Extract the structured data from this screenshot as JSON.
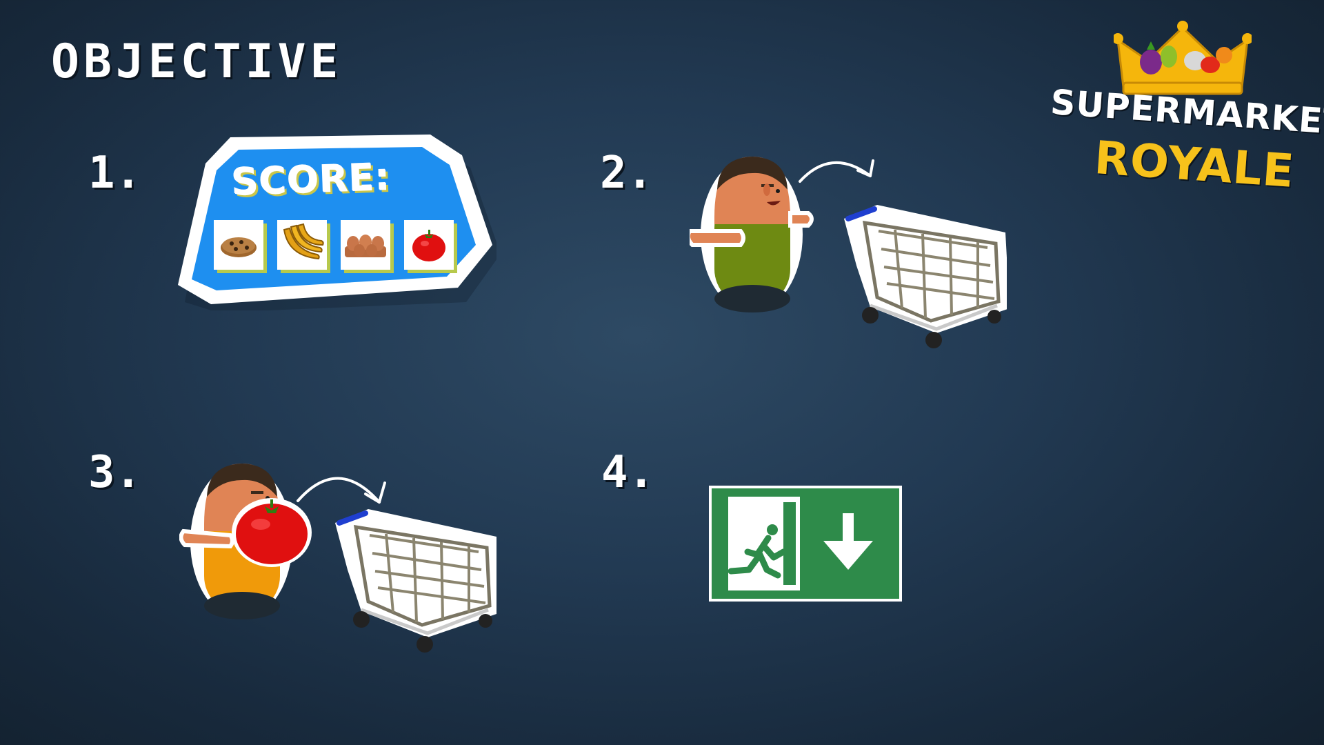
{
  "header": {
    "title": "OBJECTIVE"
  },
  "steps": [
    {
      "number": "1."
    },
    {
      "number": "2."
    },
    {
      "number": "3."
    },
    {
      "number": "4."
    }
  ],
  "score_panel": {
    "label": "SCORE:",
    "items": [
      "cookie-icon",
      "banana-icon",
      "eggs-icon",
      "tomato-icon"
    ]
  },
  "logo": {
    "line1": "SUPERMARKET",
    "line2": "ROYALE"
  },
  "colors": {
    "background": "#223a53",
    "panel_blue": "#1e8ff0",
    "exit_green": "#2e8b4a",
    "logo_yellow": "#f7c21b",
    "shirt_green": "#6e8a12",
    "shirt_orange": "#f09a0a"
  }
}
